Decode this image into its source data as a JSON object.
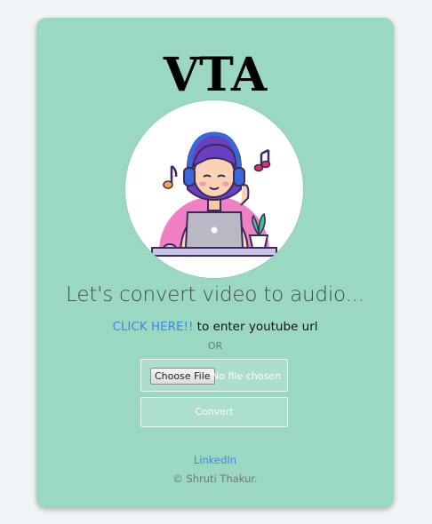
{
  "app": {
    "title": "VTA",
    "tagline": "Let's convert video to audio...",
    "illustration_icon": "person-with-headphones-laptop-illustration"
  },
  "cta": {
    "link_text": "CLICK HERE!!",
    "rest_text": " to enter youtube url"
  },
  "divider": {
    "or_text": "OR"
  },
  "file_input": {
    "button_label": "Choose File",
    "status_text": "No file chosen"
  },
  "convert": {
    "label": "Convert"
  },
  "footer": {
    "linkedin_label": "LinkedIn",
    "copyright": "© Shruti Thakur."
  },
  "colors": {
    "page_bg": "#f1f4f7",
    "card_bg": "#9bd8c2",
    "link": "#3d87e0"
  }
}
